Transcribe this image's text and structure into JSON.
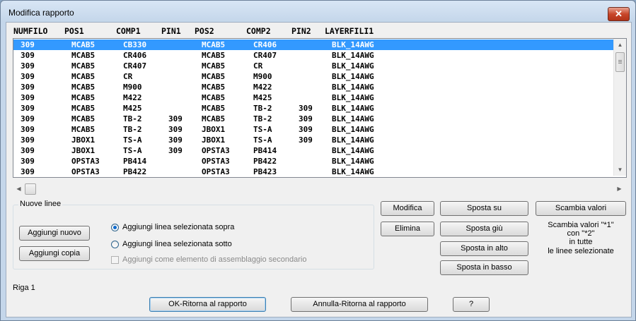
{
  "window": {
    "title": "Modifica rapporto",
    "close_label": "✕"
  },
  "columns": [
    "NUMFILO",
    "POS1",
    "COMP1",
    "PIN1",
    "POS2",
    "COMP2",
    "PIN2",
    "LAYERFILI1"
  ],
  "rows": [
    [
      "309",
      "MCAB5",
      "CB330",
      "",
      "MCAB5",
      "CR406",
      "",
      "BLK_14AWG"
    ],
    [
      "309",
      "MCAB5",
      "CR406",
      "",
      "MCAB5",
      "CR407",
      "",
      "BLK_14AWG"
    ],
    [
      "309",
      "MCAB5",
      "CR407",
      "",
      "MCAB5",
      "CR",
      "",
      "BLK_14AWG"
    ],
    [
      "309",
      "MCAB5",
      "CR",
      "",
      "MCAB5",
      "M900",
      "",
      "BLK_14AWG"
    ],
    [
      "309",
      "MCAB5",
      "M900",
      "",
      "MCAB5",
      "M422",
      "",
      "BLK_14AWG"
    ],
    [
      "309",
      "MCAB5",
      "M422",
      "",
      "MCAB5",
      "M425",
      "",
      "BLK_14AWG"
    ],
    [
      "309",
      "MCAB5",
      "M425",
      "",
      "MCAB5",
      "TB-2",
      "309",
      "BLK_14AWG"
    ],
    [
      "309",
      "MCAB5",
      "TB-2",
      "309",
      "MCAB5",
      "TB-2",
      "309",
      "BLK_14AWG"
    ],
    [
      "309",
      "MCAB5",
      "TB-2",
      "309",
      "JBOX1",
      "TS-A",
      "309",
      "BLK_14AWG"
    ],
    [
      "309",
      "JBOX1",
      "TS-A",
      "309",
      "JBOX1",
      "TS-A",
      "309",
      "BLK_14AWG"
    ],
    [
      "309",
      "JBOX1",
      "TS-A",
      "309",
      "OPSTA3",
      "PB414",
      "",
      "BLK_14AWG"
    ],
    [
      "309",
      "OPSTA3",
      "PB414",
      "",
      "OPSTA3",
      "PB422",
      "",
      "BLK_14AWG"
    ],
    [
      "309",
      "OPSTA3",
      "PB422",
      "",
      "OPSTA3",
      "PB423",
      "",
      "BLK_14AWG"
    ]
  ],
  "selected_row": 0,
  "nuove_linee": {
    "label": "Nuove linee",
    "add_new": "Aggiungi nuovo",
    "add_copy": "Aggiungi copia",
    "radio_above": "Aggiungi linea selezionata sopra",
    "radio_below": "Aggiungi linea selezionata sotto",
    "check_sub": "Aggiungi come elemento di assemblaggio secondario"
  },
  "actions": {
    "modifica": "Modifica",
    "elimina": "Elimina",
    "sposta_su": "Sposta su",
    "sposta_giu": "Sposta giù",
    "sposta_alto": "Sposta in alto",
    "sposta_basso": "Sposta in basso",
    "scambia": "Scambia valori",
    "scambia_info_1": "Scambia valori \"*1\"",
    "scambia_info_2": "con \"*2\"",
    "scambia_info_3": "in tutte",
    "scambia_info_4": "le linee selezionate"
  },
  "status": "Riga 1",
  "footer": {
    "ok": "OK-Ritorna al rapporto",
    "cancel": "Annulla-Ritorna al rapporto",
    "help": "?"
  }
}
